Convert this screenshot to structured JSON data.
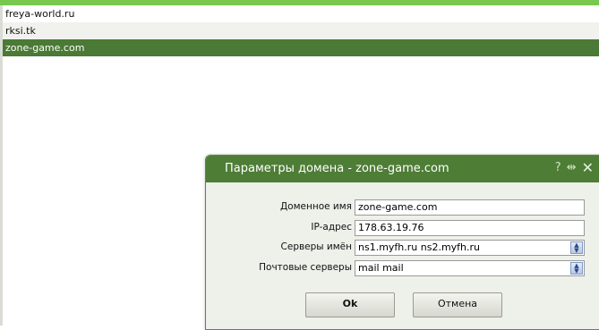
{
  "domains": [
    {
      "name": "freya-world.ru",
      "selected": false
    },
    {
      "name": "rksi.tk",
      "selected": false
    },
    {
      "name": "zone-game.com",
      "selected": true
    }
  ],
  "dialog": {
    "title": "Параметры домена - zone-game.com",
    "icons": [
      "help-icon",
      "resize-icon",
      "close-icon"
    ],
    "help_glyph": "?",
    "resize_glyph": "⇹",
    "close_glyph": "✕",
    "fields": {
      "domain_name": {
        "label": "Доменное имя",
        "value": "zone-game.com"
      },
      "ip_address": {
        "label": "IP-адрес",
        "value": "178.63.19.76"
      },
      "name_servers": {
        "label": "Серверы имён",
        "value": "ns1.myfh.ru ns2.myfh.ru"
      },
      "mail_servers": {
        "label": "Почтовые серверы",
        "value": "mail mail"
      }
    },
    "ok_label": "Ok",
    "cancel_label": "Отмена"
  },
  "colors": {
    "accent": "#78c850",
    "header": "#4e7d36",
    "selected_row": "#4a7a35"
  }
}
